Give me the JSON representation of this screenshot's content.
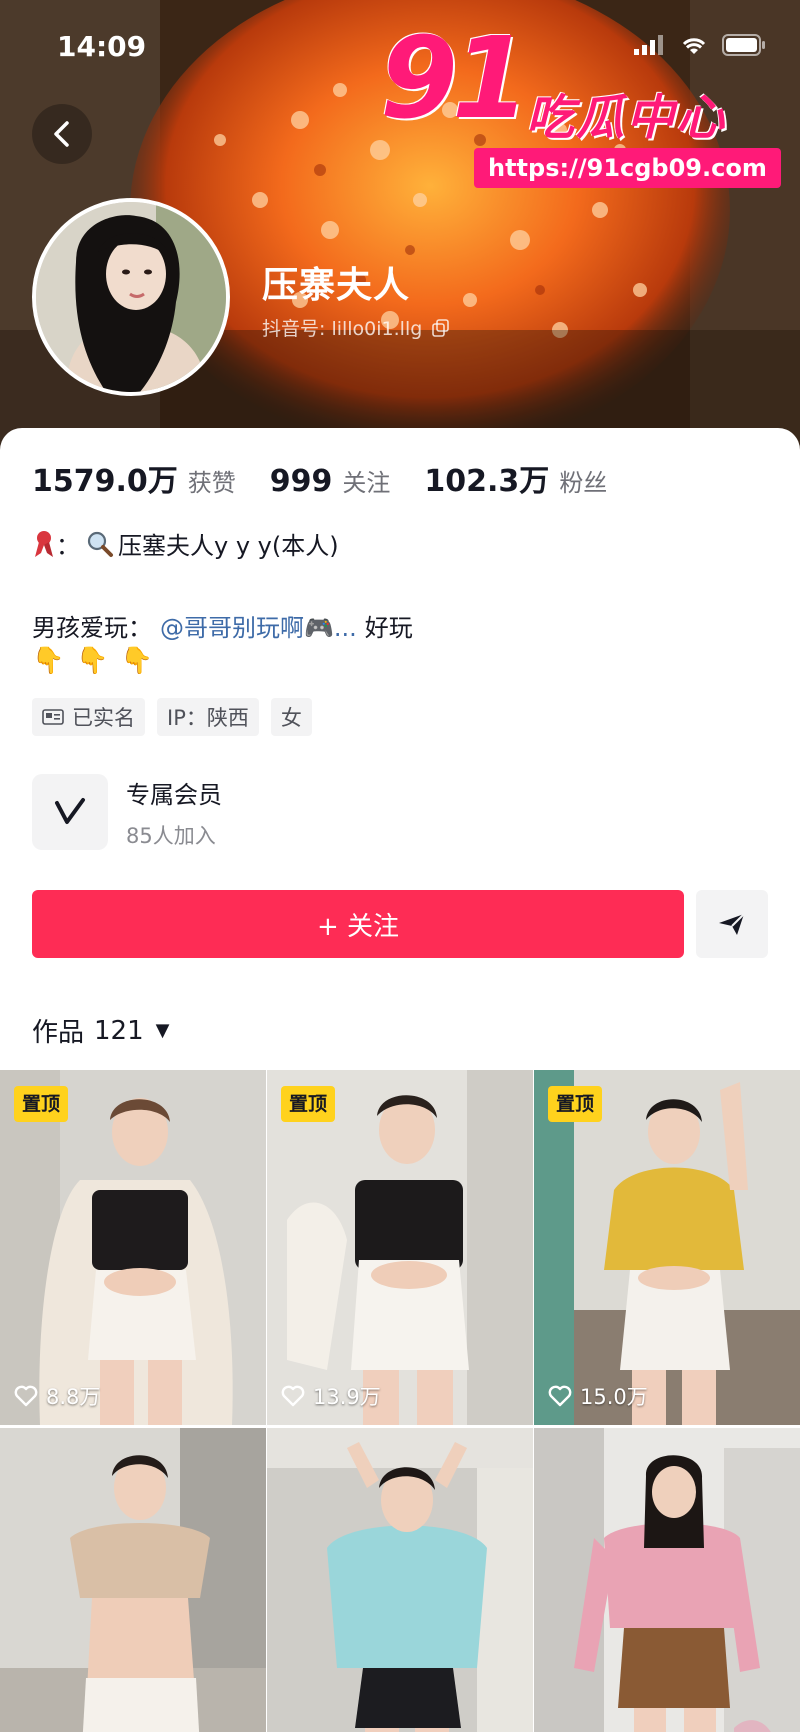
{
  "status_bar": {
    "time": "14:09"
  },
  "watermark": {
    "number": "91",
    "site_name": "吃瓜中心",
    "url": "https://91cgb09.com"
  },
  "profile": {
    "nickname": "压寨夫人",
    "douyin_id": "抖音号: lillo0i1.llg",
    "stats": [
      {
        "value": "1579.0万",
        "label": "获赞"
      },
      {
        "value": "999",
        "label": "关注"
      },
      {
        "value": "102.3万",
        "label": "粉丝"
      }
    ],
    "signature_line1": {
      "prefix": "：",
      "text": "压塞夫人y y y(本人)"
    },
    "signature_line2": {
      "prefix": "男孩爱玩：",
      "mention": "@哥哥别玩啊🎮...",
      "suffix": "好玩"
    },
    "emoji_row": [
      "👇",
      "👇",
      "👇"
    ],
    "tags": [
      "已实名",
      "IP：陕西",
      "女"
    ]
  },
  "membership": {
    "title": "专属会员",
    "subtitle": "85人加入"
  },
  "actions": {
    "follow_label": "+ 关注"
  },
  "works": {
    "label": "作品",
    "count": "121"
  },
  "videos": [
    {
      "pinned": "置顶",
      "likes": "8.8万"
    },
    {
      "pinned": "置顶",
      "likes": "13.9万"
    },
    {
      "pinned": "置顶",
      "likes": "15.0万"
    },
    {
      "pinned": "",
      "likes": ""
    },
    {
      "pinned": "",
      "likes": ""
    },
    {
      "pinned": "",
      "likes": ""
    }
  ],
  "colors": {
    "accent": "#fe2c55",
    "pin_badge": "#ffd21d",
    "mention": "#3e6ba8",
    "watermark": "#ff1a78"
  }
}
